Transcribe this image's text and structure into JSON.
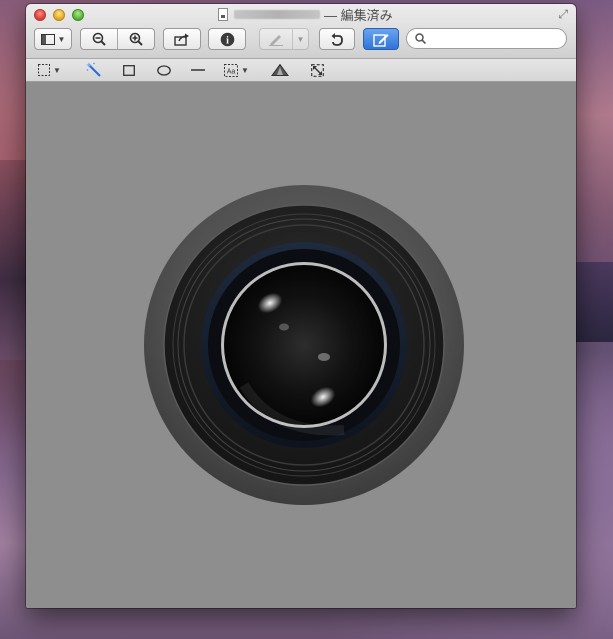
{
  "window": {
    "title_suffix": "— 編集済み",
    "accent": "#2f74d8",
    "background": "#8e8e8e"
  },
  "toolbar": {
    "view_menu_icon": "sidebar-view-icon",
    "zoom_out_icon": "zoom-out-icon",
    "zoom_in_icon": "zoom-in-icon",
    "share_icon": "share-icon",
    "info_icon": "info-icon",
    "highlight_icon": "highlight-pen-icon",
    "rotate_icon": "rotate-icon",
    "markup_icon": "markup-pen-icon",
    "search": {
      "value": "",
      "placeholder": ""
    }
  },
  "markup_tools": [
    {
      "name": "rectangular-selection",
      "icon": "dotted-rectangle-icon"
    },
    {
      "name": "instant-alpha",
      "icon": "magic-wand-icon"
    },
    {
      "name": "rectangle-shape",
      "icon": "rectangle-icon"
    },
    {
      "name": "oval-shape",
      "icon": "oval-icon"
    },
    {
      "name": "line-shape",
      "icon": "line-icon"
    },
    {
      "name": "text",
      "icon": "text-box-icon"
    },
    {
      "name": "adjust-color",
      "icon": "prism-icon"
    },
    {
      "name": "adjust-size",
      "icon": "resize-icon"
    }
  ],
  "document": {
    "image": "camera-lens-illustration"
  }
}
